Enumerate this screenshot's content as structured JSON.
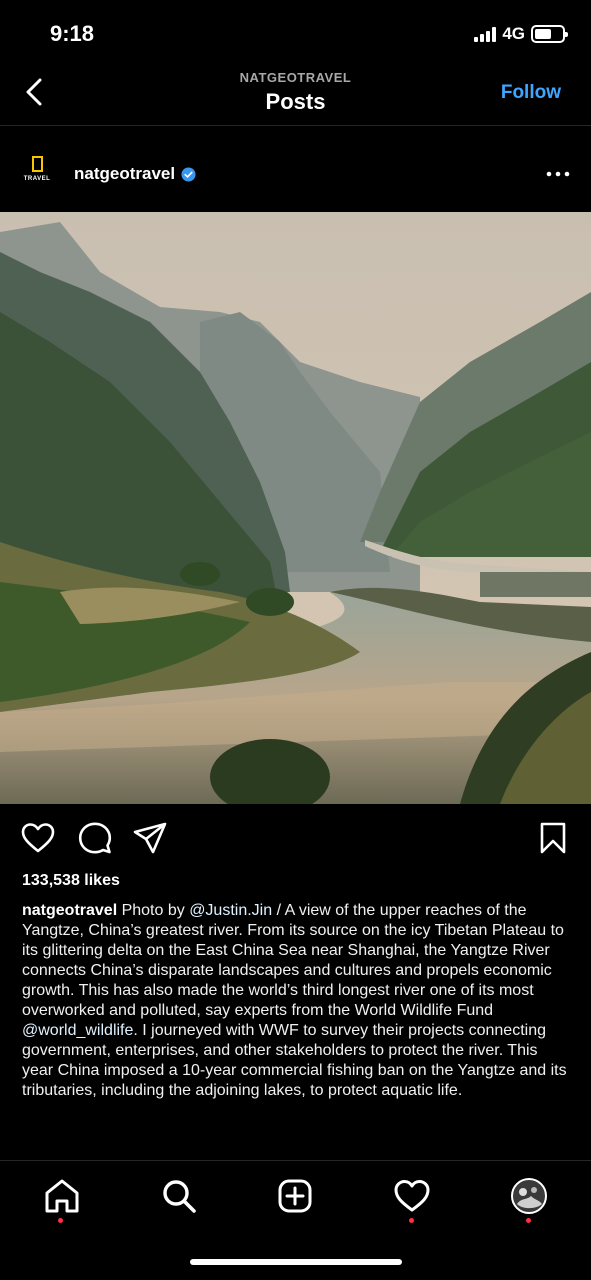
{
  "status_bar": {
    "time": "9:18",
    "network": "4G"
  },
  "header": {
    "account": "NATGEOTRAVEL",
    "title": "Posts",
    "follow_label": "Follow"
  },
  "post": {
    "avatar_text": "TRAVEL",
    "username": "natgeotravel",
    "likes": "133,538 likes",
    "caption": {
      "username": "natgeotravel",
      "part1": " Photo by ",
      "mention1": "@Justin.Jin",
      "part2": " / A view of the upper reaches of the Yangtze, China’s greatest river. From its source on the icy Tibetan Plateau to its glittering delta on the East China Sea near Shanghai, the Yangtze River connects China’s disparate landscapes and cultures and propels economic growth. This has also made the world’s third longest river one of its most overworked and polluted, say experts from the World Wildlife Fund ",
      "mention2": "@world_wildlife",
      "part3": ". I journeyed with WWF to survey their projects connecting government, enterprises, and other stakeholders to protect the river. This year China imposed a 10-year commercial fishing ban on the Yangtze and its tributaries, including the adjoining lakes, to protect aquatic life."
    }
  },
  "colors": {
    "accent": "#3ea6ff",
    "verified": "#3897f0",
    "ng_yellow": "#f7c600",
    "notification_dot": "#ff3040"
  },
  "icons": {
    "actions": [
      "heart-icon",
      "comment-icon",
      "share-icon",
      "bookmark-icon"
    ],
    "bottom_nav": [
      "home-icon",
      "search-icon",
      "add-post-icon",
      "activity-icon",
      "profile-avatar"
    ]
  }
}
